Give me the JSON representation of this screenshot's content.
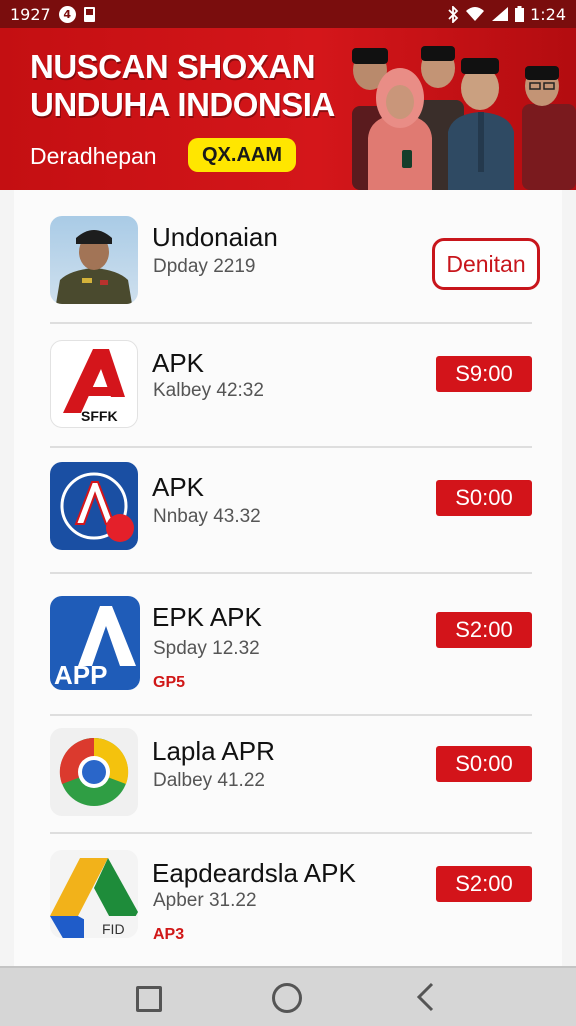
{
  "status_bar": {
    "time_left": "1927",
    "notification_badge": "4",
    "time_right": "1:24",
    "icons": [
      "bluetooth-icon",
      "wifi-icon",
      "signal-icon",
      "battery-icon"
    ]
  },
  "banner": {
    "title_line1": "NUSCAN SHOXAN",
    "title_line2": "UNDUHA INDONSIA",
    "tagline": "Deradhepan",
    "badge": "QX.AAM",
    "colors": {
      "background": "#c40f12",
      "badge": "#ffe600"
    }
  },
  "apps": [
    {
      "name": "Undonaian",
      "meta": "Dpday 2219",
      "tag": "",
      "action": "Denitan",
      "action_style": "outline",
      "icon": "officer-photo-icon"
    },
    {
      "name": "APK",
      "meta": "Kalbey 42:32",
      "tag": "",
      "action": "S9:00",
      "action_style": "filled",
      "icon": "red-a-sffk-icon",
      "icon_text": "SFFK"
    },
    {
      "name": "APK",
      "meta": "Nnbay 43.32",
      "tag": "",
      "action": "S0:00",
      "action_style": "filled",
      "icon": "blue-emblem-a-icon"
    },
    {
      "name": "EPK  APK",
      "meta": "Spday 12.32",
      "tag": "GP5",
      "action": "S2:00",
      "action_style": "filled",
      "icon": "app-a-icon",
      "icon_text": "APP"
    },
    {
      "name": "Lapla APR",
      "meta": "Dalbey 41.22",
      "tag": "",
      "action": "S0:00",
      "action_style": "filled",
      "icon": "chrome-icon"
    },
    {
      "name": "Eapdeardsla APK",
      "meta": "Apber 31.22",
      "tag": "AP3",
      "action": "S2:00",
      "action_style": "filled",
      "icon": "drive-triangle-icon",
      "icon_text": "FID"
    }
  ],
  "nav_bar": {
    "buttons": [
      "recents-button",
      "home-button",
      "back-button"
    ]
  },
  "colors": {
    "accent": "#d3141a",
    "status_bar": "#7a0d0d"
  }
}
